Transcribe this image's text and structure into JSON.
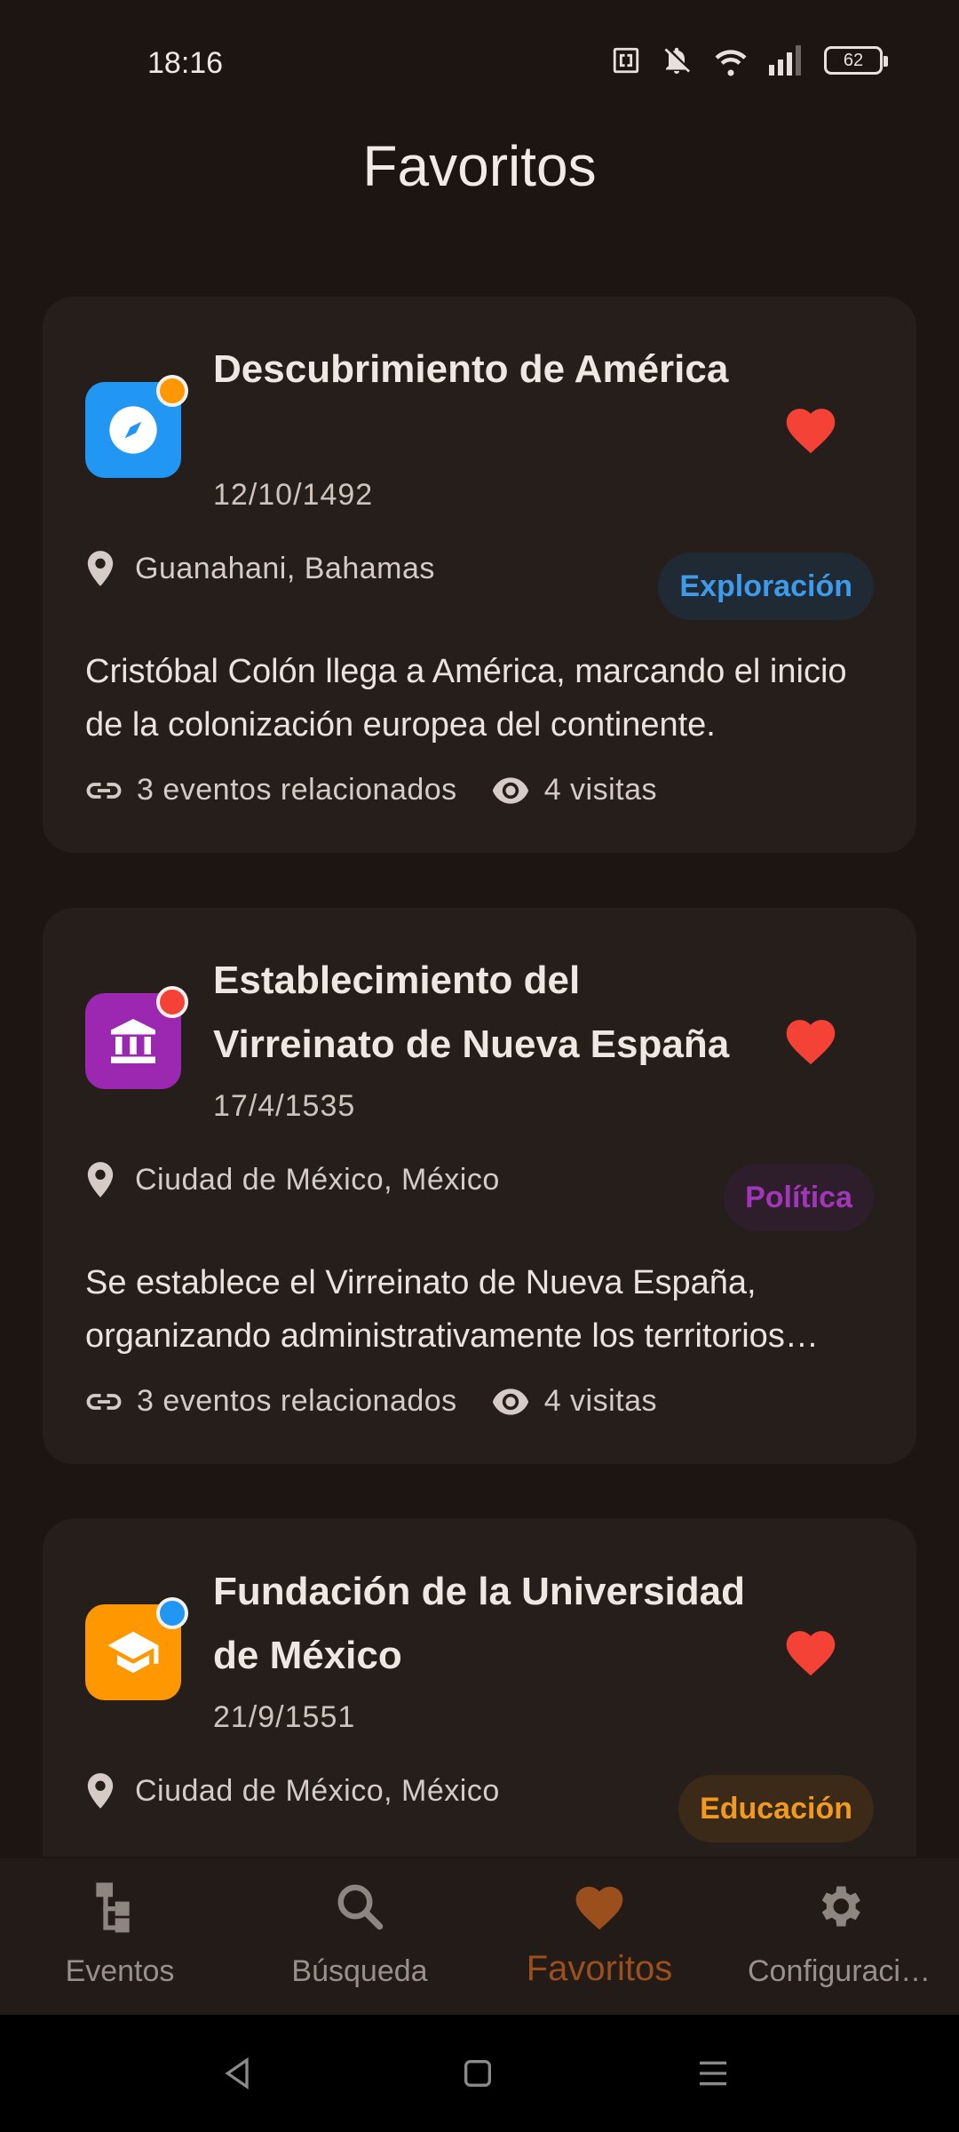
{
  "status": {
    "time": "18:16",
    "battery": "62"
  },
  "page": {
    "title": "Favoritos"
  },
  "colors": {
    "accent": "#9b4f1d",
    "heart": "#f44336",
    "background": "#1c1512",
    "card": "#251e1b"
  },
  "events": [
    {
      "title": "Descubrimiento de América",
      "date": "12/10/1492",
      "location": "Guanahani, Bahamas",
      "category": "Exploración",
      "category_color": "#3d9be9",
      "category_bg": "#1f2a35",
      "icon": "compass-icon",
      "icon_bg": "#2196f3",
      "dot_color": "#ff9800",
      "description": "Cristóbal Colón llega a América, marcando el inicio de la colonización europea del continente.",
      "related": "3 eventos relacionados",
      "visits": "4 visitas"
    },
    {
      "title": "Establecimiento del Virreinato de Nueva España",
      "date": "17/4/1535",
      "location": "Ciudad de México, México",
      "category": "Política",
      "category_color": "#a236b8",
      "category_bg": "#2e1e2c",
      "icon": "institution-icon",
      "icon_bg": "#9c27b0",
      "dot_color": "#f44336",
      "description": "Se establece el Virreinato de Nueva España, organizando administrativamente los territorios conquistados.",
      "related": "3 eventos relacionados",
      "visits": "4 visitas"
    },
    {
      "title": "Fundación de la Universidad de México",
      "date": "21/9/1551",
      "location": "Ciudad de México, México",
      "category": "Educación",
      "category_color": "#f29a20",
      "category_bg": "#3a2a17",
      "icon": "graduation-cap-icon",
      "icon_bg": "#ff9800",
      "dot_color": "#2196f3",
      "description": "",
      "related": "",
      "visits": ""
    }
  ],
  "nav": [
    {
      "label": "Eventos",
      "icon": "timeline-icon"
    },
    {
      "label": "Búsqueda",
      "icon": "search-icon"
    },
    {
      "label": "Favoritos",
      "icon": "heart-icon",
      "active": true
    },
    {
      "label": "Configuraci…",
      "icon": "gear-icon"
    }
  ]
}
